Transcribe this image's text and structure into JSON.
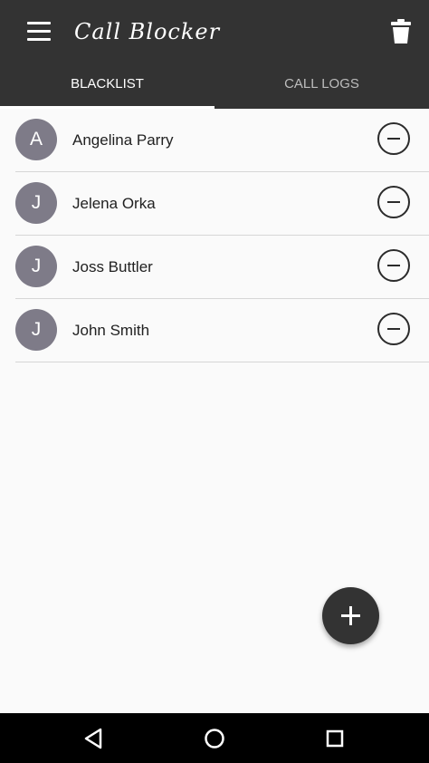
{
  "app": {
    "title": "Call Blocker",
    "colors": {
      "appbar": "#333333",
      "avatar": "#7e7b88",
      "background": "#fafafa",
      "navbar": "#000000"
    }
  },
  "toolbar": {
    "menu_icon": "hamburger-menu-icon",
    "trash_icon": "trash-can-icon"
  },
  "tabs": [
    {
      "label": "BLACKLIST",
      "selected": true
    },
    {
      "label": "CALL LOGS",
      "selected": false
    }
  ],
  "blacklist": [
    {
      "initial": "A",
      "name": "Angelina Parry"
    },
    {
      "initial": "J",
      "name": "Jelena Orka"
    },
    {
      "initial": "J",
      "name": "Joss Buttler"
    },
    {
      "initial": "J",
      "name": "John Smith"
    }
  ],
  "row_action_icon": "remove-circle-icon",
  "fab": {
    "icon": "plus-icon"
  },
  "system_nav": {
    "back_icon": "back-triangle-icon",
    "home_icon": "home-circle-icon",
    "recents_icon": "recents-square-icon"
  }
}
